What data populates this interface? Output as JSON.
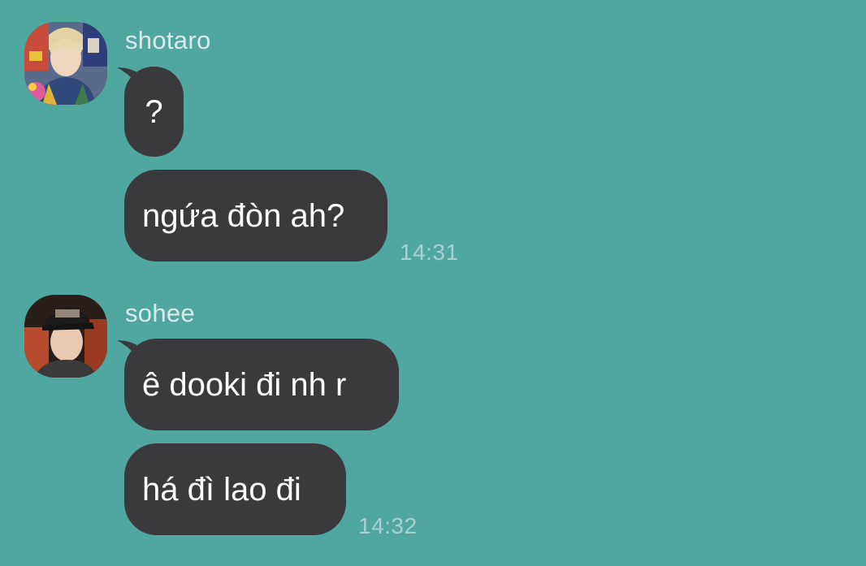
{
  "conversation": {
    "groups": [
      {
        "sender": "shotaro",
        "avatar_icon": "user-avatar-shotaro",
        "messages": [
          "?",
          "ngứa đòn ah?"
        ],
        "time": "14:31"
      },
      {
        "sender": "sohee",
        "avatar_icon": "user-avatar-sohee",
        "messages": [
          "ê dooki đi nh r",
          "há đì lao đi"
        ],
        "time": "14:32"
      }
    ]
  },
  "colors": {
    "background": "#50a7a0",
    "bubble": "#3a3a3c",
    "bubble_text": "#ffffff",
    "sender_name": "#d8ebe9",
    "timestamp": "#a8d2ce"
  }
}
